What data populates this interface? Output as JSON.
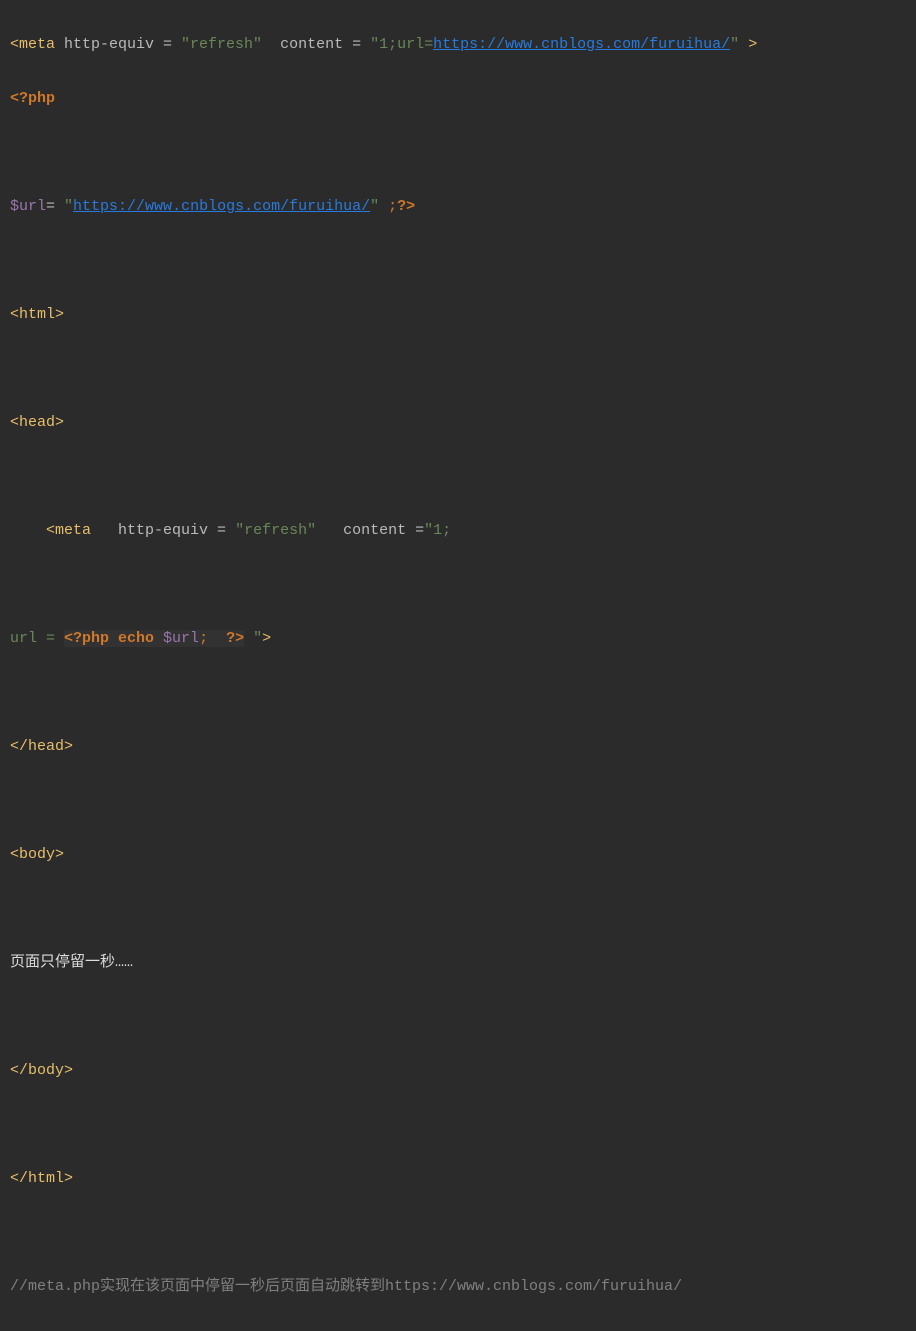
{
  "code": {
    "l1": {
      "t1": "<meta ",
      "t2": "http-equiv = ",
      "t3": "\"refresh\"",
      "t4": "  content = ",
      "t5": "\"1;url=",
      "t6": "https://www.cnblogs.com/furuihua/",
      "t7": "\" ",
      "t8": ">"
    },
    "l2": {
      "t1": "<?php"
    },
    "l3": "",
    "l4": {
      "t1": "$url",
      "t2": "= ",
      "t3": "\"",
      "t4": "https://www.cnblogs.com/furuihua/",
      "t5": "\" ",
      "t6": ";",
      "t7": "?>"
    },
    "l5": "",
    "l6": {
      "t1": "<html>"
    },
    "l7": "",
    "l8": {
      "t1": "<head>"
    },
    "l9": "",
    "l10": {
      "t1": "    <meta   ",
      "t2": "http-equiv = ",
      "t3": "\"refresh\"",
      "t4": "   content =",
      "t5": "\"1;"
    },
    "l11": "",
    "l12": {
      "t1": "url = ",
      "t2": "<?php echo ",
      "t3": "$url",
      "t4": ";  ",
      "t5": "?>",
      "t6": " \"",
      "t7": ">"
    },
    "l13": "",
    "l14": {
      "t1": "</head>"
    },
    "l15": "",
    "l16": {
      "t1": "<body>"
    },
    "l17": "",
    "l18": {
      "t1": "页面只停留一秒……"
    },
    "l19": "",
    "l20": {
      "t1": "</body>"
    },
    "l21": "",
    "l22": {
      "t1": "</html>"
    },
    "l23": "",
    "l24": {
      "t1": "//meta.php实现在该页面中停留一秒后页面自动跳转到https://www.cnblogs.com/furuihua/"
    }
  }
}
